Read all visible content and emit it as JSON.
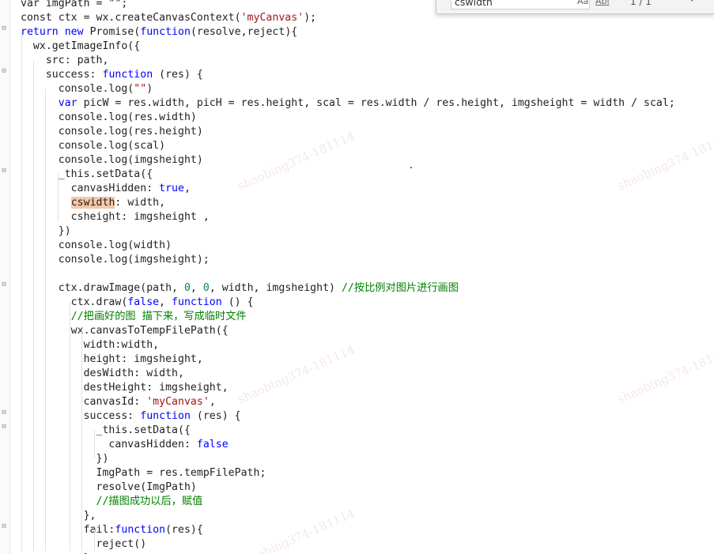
{
  "find_widget": {
    "search_value": "cswidth",
    "match_case": "Aa",
    "whole_word": "Abl",
    "match_count": "1 / 1",
    "prev_arrow": "←"
  },
  "code_lines": [
    [
      [
        "txt",
        "var imgPath = \"\";"
      ]
    ],
    [
      [
        "txt",
        "const ctx = wx.createCanvasContext("
      ],
      [
        "str",
        "'myCanvas'"
      ],
      [
        "txt",
        ");"
      ]
    ],
    [
      [
        "kw",
        "return new "
      ],
      [
        "txt",
        "Promise("
      ],
      [
        "kw",
        "function"
      ],
      [
        "txt",
        "(resolve,reject){"
      ]
    ],
    [
      [
        "txt",
        "  wx.getImageInfo({"
      ]
    ],
    [
      [
        "txt",
        "    src: path,"
      ]
    ],
    [
      [
        "txt",
        "    success: "
      ],
      [
        "kw",
        "function"
      ],
      [
        "txt",
        " (res) {"
      ]
    ],
    [
      [
        "txt",
        "      console.log("
      ],
      [
        "str",
        "\"\""
      ],
      [
        "txt",
        ")"
      ]
    ],
    [
      [
        "txt",
        "      "
      ],
      [
        "kw",
        "var"
      ],
      [
        "txt",
        " picW = res.width, picH = res.height, scal = res.width / res.height, imgsheight = width / scal;"
      ]
    ],
    [
      [
        "txt",
        "      console.log(res.width)"
      ]
    ],
    [
      [
        "txt",
        "      console.log(res.height)"
      ]
    ],
    [
      [
        "txt",
        "      console.log(scal)"
      ]
    ],
    [
      [
        "txt",
        "      console.log(imgsheight)"
      ]
    ],
    [
      [
        "txt",
        "      _this.setData({"
      ]
    ],
    [
      [
        "txt",
        "        canvasHidden: "
      ],
      [
        "kw",
        "true"
      ],
      [
        "txt",
        ","
      ]
    ],
    [
      [
        "txt",
        "        "
      ],
      [
        "hl",
        "cswidth"
      ],
      [
        "txt",
        ": width,"
      ]
    ],
    [
      [
        "txt",
        "        csheight: imgsheight ,"
      ]
    ],
    [
      [
        "txt",
        "      })"
      ]
    ],
    [
      [
        "txt",
        "      console.log(width)"
      ]
    ],
    [
      [
        "txt",
        "      console.log(imgsheight);"
      ]
    ],
    [
      [
        "txt",
        ""
      ]
    ],
    [
      [
        "txt",
        "      ctx.drawImage(path, "
      ],
      [
        "num",
        "0"
      ],
      [
        "txt",
        ", "
      ],
      [
        "num",
        "0"
      ],
      [
        "txt",
        ", width, imgsheight) "
      ],
      [
        "cmt",
        "//按比例对图片进行画图"
      ]
    ],
    [
      [
        "txt",
        "        ctx.draw("
      ],
      [
        "kw",
        "false"
      ],
      [
        "txt",
        ", "
      ],
      [
        "kw",
        "function"
      ],
      [
        "txt",
        " () {"
      ]
    ],
    [
      [
        "txt",
        "        "
      ],
      [
        "cmt",
        "//把画好的图 描下来，写成临时文件"
      ]
    ],
    [
      [
        "txt",
        "        wx.canvasToTempFilePath({"
      ]
    ],
    [
      [
        "txt",
        "          width:width,"
      ]
    ],
    [
      [
        "txt",
        "          height: imgsheight,"
      ]
    ],
    [
      [
        "txt",
        "          desWidth: width,"
      ]
    ],
    [
      [
        "txt",
        "          destHeight: imgsheight,"
      ]
    ],
    [
      [
        "txt",
        "          canvasId: "
      ],
      [
        "str",
        "'myCanvas'"
      ],
      [
        "txt",
        ","
      ]
    ],
    [
      [
        "txt",
        "          success: "
      ],
      [
        "kw",
        "function"
      ],
      [
        "txt",
        " (res) {"
      ]
    ],
    [
      [
        "txt",
        "            _this.setData({"
      ]
    ],
    [
      [
        "txt",
        "              canvasHidden: "
      ],
      [
        "kw",
        "false"
      ]
    ],
    [
      [
        "txt",
        "            })"
      ]
    ],
    [
      [
        "txt",
        "            ImgPath = res.tempFilePath;"
      ]
    ],
    [
      [
        "txt",
        "            resolve(ImgPath)"
      ]
    ],
    [
      [
        "txt",
        "            "
      ],
      [
        "cmt",
        "//描图成功以后，赋值"
      ]
    ],
    [
      [
        "txt",
        "          },"
      ]
    ],
    [
      [
        "txt",
        "          fail:"
      ],
      [
        "kw",
        "function"
      ],
      [
        "txt",
        "(res){"
      ]
    ],
    [
      [
        "txt",
        "            reject()"
      ]
    ],
    [
      [
        "txt",
        "          }"
      ]
    ]
  ],
  "watermark_text": "shaobing374-181114",
  "colors": {
    "keyword": "#0000ff",
    "string": "#a31515",
    "number": "#098658",
    "comment": "#008000",
    "highlight": "#f5c8a8"
  }
}
